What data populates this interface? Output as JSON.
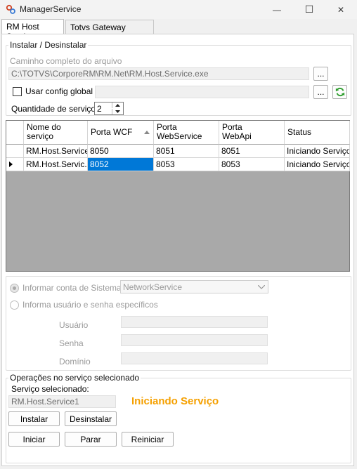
{
  "window": {
    "title": "ManagerService",
    "minimize_glyph": "—",
    "maximize_glyph": "☐",
    "close_glyph": "✕"
  },
  "tabs": [
    {
      "label": "RM Host Service",
      "active": true
    },
    {
      "label": "Totvs Gateway Manager",
      "active": false
    }
  ],
  "install_group": {
    "legend": "Instalar / Desinstalar",
    "path_label": "Caminho completo do arquivo",
    "path_value": "C:\\TOTVS\\CorporeRM\\RM.Net\\RM.Host.Service.exe",
    "browse_label": "...",
    "use_global_config_label": "Usar config global",
    "use_global_config_checked": false,
    "global_config_value": "",
    "global_browse_label": "...",
    "refresh_icon": "refresh-icon",
    "quantity_label": "Quantidade de serviços",
    "quantity_value": "2"
  },
  "grid": {
    "columns": [
      "Nome do serviço",
      "Porta WCF",
      "Porta WebService",
      "Porta WebApi",
      "Status"
    ],
    "rows": [
      {
        "name": "RM.Host.Service",
        "wcf": "8050",
        "ws": "8051",
        "api": "8051",
        "status": "Iniciando Serviço",
        "current": false
      },
      {
        "name": "RM.Host.Servic...",
        "wcf": "8052",
        "ws": "8053",
        "api": "8053",
        "status": "Iniciando Serviço",
        "current": true
      }
    ]
  },
  "account_group": {
    "system_account_label": "Informar conta de Sistema",
    "system_account_value": "NetworkService",
    "specific_user_label": "Informa usuário e senha específicos",
    "user_label": "Usuário",
    "password_label": "Senha",
    "domain_label": "Domínio"
  },
  "operations_group": {
    "legend": "Operações no serviço selecionado",
    "selected_label": "Serviço selecionado:",
    "selected_value": "RM.Host.Service1",
    "status_text": "Iniciando Serviço",
    "status_color": "#f5a000",
    "install_label": "Instalar",
    "uninstall_label": "Desinstalar",
    "start_label": "Iniciar",
    "stop_label": "Parar",
    "restart_label": "Reiniciar"
  }
}
